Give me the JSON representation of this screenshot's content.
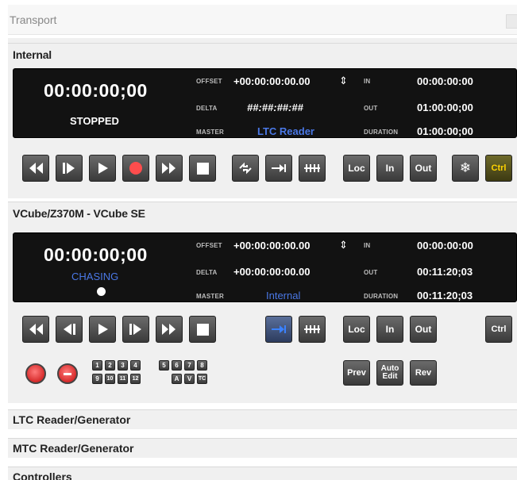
{
  "window": {
    "title": "Transport"
  },
  "internal": {
    "header": "Internal",
    "timecode": "00:00:00;00",
    "status": "STOPPED",
    "offset_label": "OFFSET",
    "offset_value": "+00:00:00:00.00",
    "delta_label": "DELTA",
    "delta_value": "##:##:##:##",
    "master_label": "MASTER",
    "master_value": "LTC Reader",
    "in_label": "IN",
    "in_value": "00:00:00:00",
    "out_label": "OUT",
    "out_value": "01:00:00;00",
    "duration_label": "DURATION",
    "duration_value": "01:00:00;00",
    "loc_label": "Loc",
    "in_btn_label": "In",
    "out_btn_label": "Out",
    "ctrl_label": "Ctrl"
  },
  "vcube": {
    "header": "VCube/Z370M - VCube SE",
    "timecode": "00:00:00;00",
    "status": "CHASING",
    "offset_label": "OFFSET",
    "offset_value": "+00:00:00:00.00",
    "delta_label": "DELTA",
    "delta_value": "+00:00:00:00.00",
    "master_label": "MASTER",
    "master_value": "Internal",
    "in_label": "IN",
    "in_value": "00:00:00:00",
    "out_label": "OUT",
    "out_value": "00:11:20;03",
    "duration_label": "DURATION",
    "duration_value": "00:11:20;03",
    "loc_label": "Loc",
    "in_btn_label": "In",
    "out_btn_label": "Out",
    "ctrl_label": "Ctrl",
    "prev_label": "Prev",
    "auto_edit_label": "Auto Edit",
    "rev_label": "Rev",
    "tracks": [
      "1",
      "2",
      "3",
      "4",
      "5",
      "6",
      "7",
      "8",
      "9",
      "10",
      "11",
      "12",
      "A",
      "V",
      "TC"
    ]
  },
  "collapsed_sections": [
    "LTC Reader/Generator",
    "MTC Reader/Generator",
    "Controllers"
  ],
  "colors": {
    "blue_text": "#4a78e6",
    "record_red": "#ff4d4d",
    "ctrl_yellow": "#ffd400"
  }
}
